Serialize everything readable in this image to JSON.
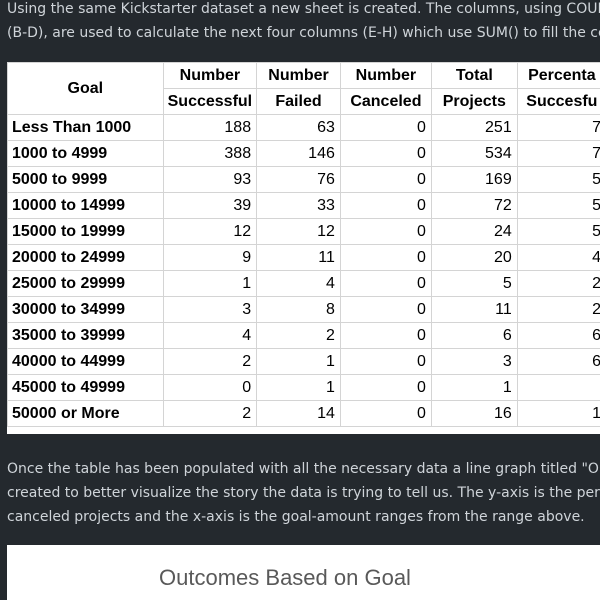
{
  "intro": {
    "line1": "Using the same Kickstarter dataset a new sheet is created. The columns, using COUN",
    "line2": "(B-D), are used to calculate the next four columns (E-H) which use SUM() to fill the ce"
  },
  "table": {
    "header": {
      "goal": "Goal",
      "col1_top": "Number",
      "col1_bottom": "Successful",
      "col2_top": "Number",
      "col2_bottom": "Failed",
      "col3_top": "Number",
      "col3_bottom": "Canceled",
      "col4_top": "Total",
      "col4_bottom": "Projects",
      "col5_top": "Percenta",
      "col5_bottom": "Succesfu"
    },
    "rows": [
      {
        "goal": "Less Than 1000",
        "successful": "188",
        "failed": "63",
        "canceled": "0",
        "total": "251",
        "pct": "7"
      },
      {
        "goal": "1000 to 4999",
        "successful": "388",
        "failed": "146",
        "canceled": "0",
        "total": "534",
        "pct": "7"
      },
      {
        "goal": "5000 to 9999",
        "successful": "93",
        "failed": "76",
        "canceled": "0",
        "total": "169",
        "pct": "5"
      },
      {
        "goal": "10000 to 14999",
        "successful": "39",
        "failed": "33",
        "canceled": "0",
        "total": "72",
        "pct": "5"
      },
      {
        "goal": "15000 to 19999",
        "successful": "12",
        "failed": "12",
        "canceled": "0",
        "total": "24",
        "pct": "5"
      },
      {
        "goal": "20000 to 24999",
        "successful": "9",
        "failed": "11",
        "canceled": "0",
        "total": "20",
        "pct": "4"
      },
      {
        "goal": "25000 to 29999",
        "successful": "1",
        "failed": "4",
        "canceled": "0",
        "total": "5",
        "pct": "2"
      },
      {
        "goal": "30000 to 34999",
        "successful": "3",
        "failed": "8",
        "canceled": "0",
        "total": "11",
        "pct": "2"
      },
      {
        "goal": "35000 to 39999",
        "successful": "4",
        "failed": "2",
        "canceled": "0",
        "total": "6",
        "pct": "6"
      },
      {
        "goal": "40000 to 44999",
        "successful": "2",
        "failed": "1",
        "canceled": "0",
        "total": "3",
        "pct": "6"
      },
      {
        "goal": "45000 to 49999",
        "successful": "0",
        "failed": "1",
        "canceled": "0",
        "total": "1",
        "pct": ""
      },
      {
        "goal": "50000 or More",
        "successful": "2",
        "failed": "14",
        "canceled": "0",
        "total": "16",
        "pct": "1"
      }
    ]
  },
  "outro": {
    "line1": "Once the table has been populated with all the necessary data a line graph titled \"Ou",
    "line2": "created to better visualize the story the data is trying to tell us. The y-axis is the perc",
    "line3": "canceled projects and the x-axis is the goal-amount ranges from the range above."
  },
  "chart": {
    "title": "Outcomes Based on Goal"
  }
}
